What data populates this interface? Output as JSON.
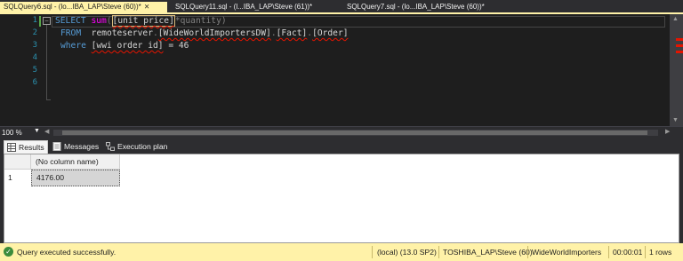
{
  "tabs": [
    {
      "label": "SQLQuery6.sql - (lo...IBA_LAP\\Steve (60))*",
      "active": true
    },
    {
      "label": "SQLQuery11.sql - (l...IBA_LAP\\Steve (61))*",
      "active": false
    },
    {
      "label": "SQLQuery7.sql - (lo...IBA_LAP\\Steve (60))*",
      "active": false
    }
  ],
  "editor": {
    "line_numbers": [
      "1",
      "2",
      "3",
      "4",
      "5",
      "6"
    ],
    "line1": {
      "kw_select": "SELECT",
      "fn_sum": "sum",
      "paren_open": "(",
      "col": "[unit price]",
      "rest": "*quantity)"
    },
    "line2": {
      "kw_from": "FROM",
      "server": "remoteserver",
      "dot1": ".",
      "db": "[WideWorldImportersDW]",
      "dot2": ".",
      "schema": "[Fact]",
      "dot3": ".",
      "table": "[Order]"
    },
    "line3": {
      "kw_where": "where",
      "col": "[wwi order id]",
      "rest": " = 46"
    }
  },
  "zoom": {
    "value": "100 %"
  },
  "results": {
    "tabs": [
      {
        "label": "Results",
        "icon": "grid-icon"
      },
      {
        "label": "Messages",
        "icon": "messages-icon"
      },
      {
        "label": "Execution plan",
        "icon": "execution-plan-icon"
      }
    ],
    "column_header": "(No column name)",
    "rows": [
      {
        "row_no": "1",
        "value": "4176.00"
      }
    ]
  },
  "status": {
    "message": "Query executed successfully.",
    "server": "(local) (13.0 SP2)",
    "user": "TOSHIBA_LAP\\Steve (60)",
    "database": "WideWorldImporters",
    "elapsed": "00:00:01",
    "rows": "1 rows"
  },
  "colors": {
    "accent": "#fff2a8",
    "editor_bg": "#1e1e1e",
    "keyword": "#569cd6",
    "function": "#ff00ff",
    "error_squiggle": "#e51400"
  }
}
